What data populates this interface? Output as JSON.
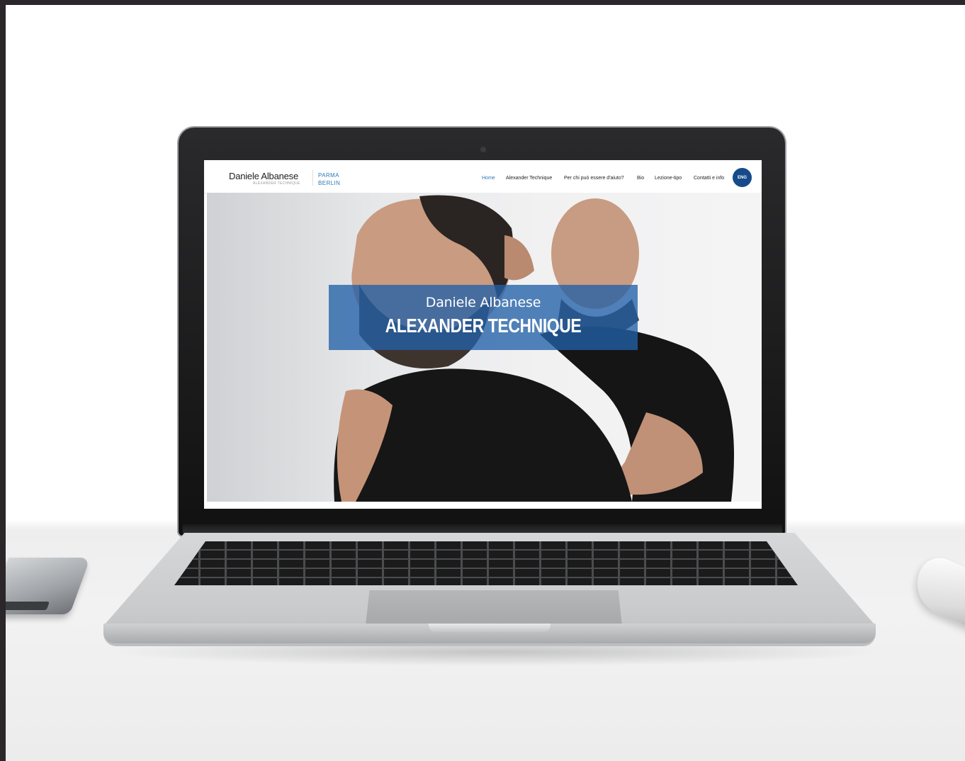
{
  "site": {
    "logo": {
      "name": "Daniele Albanese",
      "subtitle": "ALEXANDER TECHNIQUE"
    },
    "cities": [
      "PARMA",
      "BERLIN"
    ],
    "nav": [
      {
        "label": "Home",
        "active": true
      },
      {
        "label": "Alexander Technique",
        "active": false
      },
      {
        "label": "Per chi può essere d'aiuto?",
        "active": false
      },
      {
        "label": "Bio",
        "active": false
      },
      {
        "label": "Lezione-tipo",
        "active": false
      },
      {
        "label": "Contatti e info",
        "active": false
      }
    ],
    "language_button": "ENG",
    "hero": {
      "subtitle": "Daniele Albanese",
      "title": "ALEXANDER TECHNIQUE"
    }
  },
  "colors": {
    "accent": "#2d7ab5",
    "lang_button": "#174a8a",
    "hero_overlay": "#2260a8"
  }
}
